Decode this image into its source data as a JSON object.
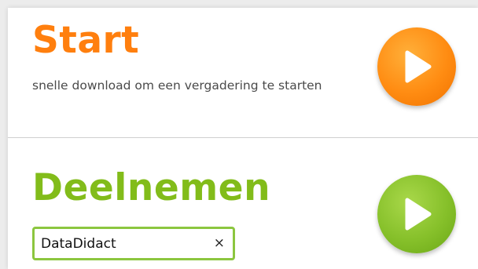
{
  "start": {
    "title": "Start",
    "description": "snelle download om een vergadering te starten",
    "button_icon": "play-icon",
    "color": "#ff7f0e"
  },
  "join": {
    "title": "Deelnemen",
    "input_value": "DataDidact",
    "clear_label": "×",
    "button_icon": "play-icon",
    "color": "#82bc1a"
  }
}
